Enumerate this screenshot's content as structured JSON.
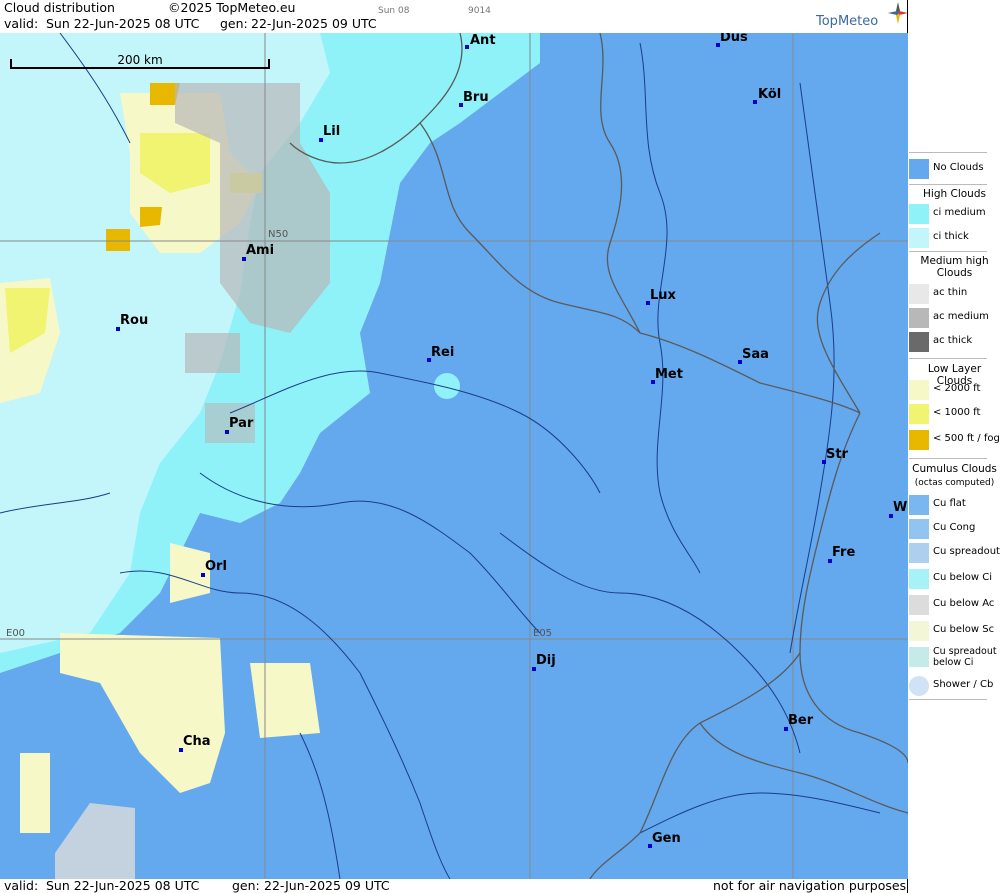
{
  "header": {
    "title": "Cloud distribution",
    "copyright": "©2025 TopMeteo.eu",
    "tab_a": "Sun 08",
    "tab_b": "9014",
    "valid_label": "valid:",
    "valid_value": "Sun  22-Jun-2025  08 UTC",
    "gen_label": "gen:",
    "gen_value": "22-Jun-2025 09 UTC",
    "logo": "TopMeteo"
  },
  "footer": {
    "valid_label": "valid:",
    "valid_value": "Sun  22-Jun-2025  08 UTC",
    "gen_label": "gen:",
    "gen_value": "22-Jun-2025 09 UTC",
    "disclaimer": "not for air navigation purposes"
  },
  "map": {
    "scale_label": "200 km",
    "grid": [
      "N50",
      "E00",
      "E05"
    ],
    "cities": [
      "Ant",
      "Düs",
      "Bru",
      "Köl",
      "Lil",
      "Ami",
      "Lux",
      "Rou",
      "Rei",
      "Met",
      "Saa",
      "Par",
      "Str",
      "W",
      "Fre",
      "Orl",
      "Dij",
      "Ber",
      "Cha",
      "Gen"
    ]
  },
  "legend": {
    "no_clouds": "No Clouds",
    "high_head": "High Clouds",
    "ci_medium": "ci medium",
    "ci_thick": "ci thick",
    "medium_head": "Medium high Clouds",
    "ac_thin": "ac thin",
    "ac_medium": "ac medium",
    "ac_thick": "ac thick",
    "low_head": "Low Layer Clouds",
    "lt2000": "< 2000 ft",
    "lt1000": "< 1000 ft",
    "lt500": "< 500 ft / fog",
    "cu_head": "Cumulus Clouds",
    "cu_sub": "(octas computed)",
    "cu_flat": "Cu flat",
    "cu_cong": "Cu Cong",
    "cu_spread": "Cu spreadout",
    "cu_below_ci": "Cu below Ci",
    "cu_below_ac": "Cu below Ac",
    "cu_below_sc": "Cu below Sc",
    "cu_spread_ci": "Cu spreadout below Ci",
    "shower": "Shower / Cb"
  },
  "colors": {
    "no_clouds": "#64a8ee",
    "ci_medium": "#8ef2f8",
    "ci_thick": "#c2f6fa",
    "low_2000": "#f6f8c8",
    "low_1000": "#f0f470",
    "low_500": "#e8b800",
    "ac_medium": "#b8b8b8"
  }
}
